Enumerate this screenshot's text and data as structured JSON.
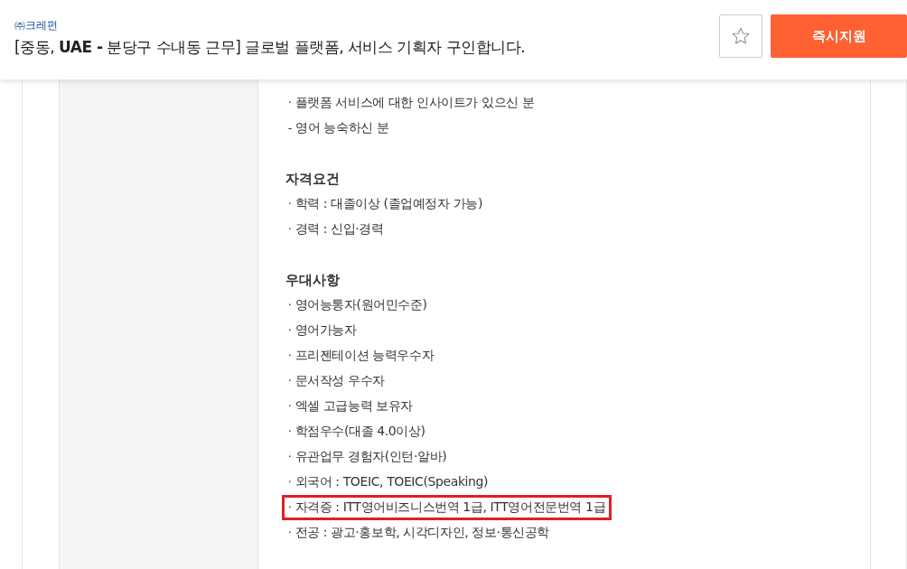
{
  "header": {
    "company": "㈜크레펀",
    "title": "[중동, **UAE -** 분당구 수내동 근무] 글로벌 플랫폼, 서비스 기획자 구인합니다.",
    "apply_button": "즉시지원",
    "bookmarked": false
  },
  "sections": [
    {
      "items": [
        {
          "marker": "·",
          "text": "플랫폼 서비스에 대한 인사이트가 있으신 분",
          "highlighted": false
        },
        {
          "marker": "-",
          "text": "영어 능숙하신 분",
          "highlighted": false
        }
      ]
    },
    {
      "heading": "자격요건",
      "items": [
        {
          "marker": "·",
          "text": "학력 : 대졸이상 (졸업예정자 가능)",
          "highlighted": false
        },
        {
          "marker": "·",
          "text": "경력 : 신입·경력",
          "highlighted": false
        }
      ]
    },
    {
      "heading": "우대사항",
      "items": [
        {
          "marker": "·",
          "text": "영어능통자(원어민수준)",
          "highlighted": false
        },
        {
          "marker": "·",
          "text": "영어가능자",
          "highlighted": false
        },
        {
          "marker": "·",
          "text": "프리젠테이션 능력우수자",
          "highlighted": false
        },
        {
          "marker": "·",
          "text": "문서작성 우수자",
          "highlighted": false
        },
        {
          "marker": "·",
          "text": "엑셀 고급능력 보유자",
          "highlighted": false
        },
        {
          "marker": "·",
          "text": "학점우수(대졸 4.0이상)",
          "highlighted": false
        },
        {
          "marker": "·",
          "text": "유관업무 경험자(인턴·알바)",
          "highlighted": false
        },
        {
          "marker": "·",
          "text": "외국어 : TOEIC, TOEIC(Speaking)",
          "highlighted": false
        },
        {
          "marker": "·",
          "text": "자격증 : ITT영어비즈니스번역 1급, ITT영어전문번역 1급",
          "highlighted": true
        },
        {
          "marker": "·",
          "text": "전공 : 광고·홍보학, 시각디자인, 정보·통신공학",
          "highlighted": false
        }
      ]
    }
  ]
}
